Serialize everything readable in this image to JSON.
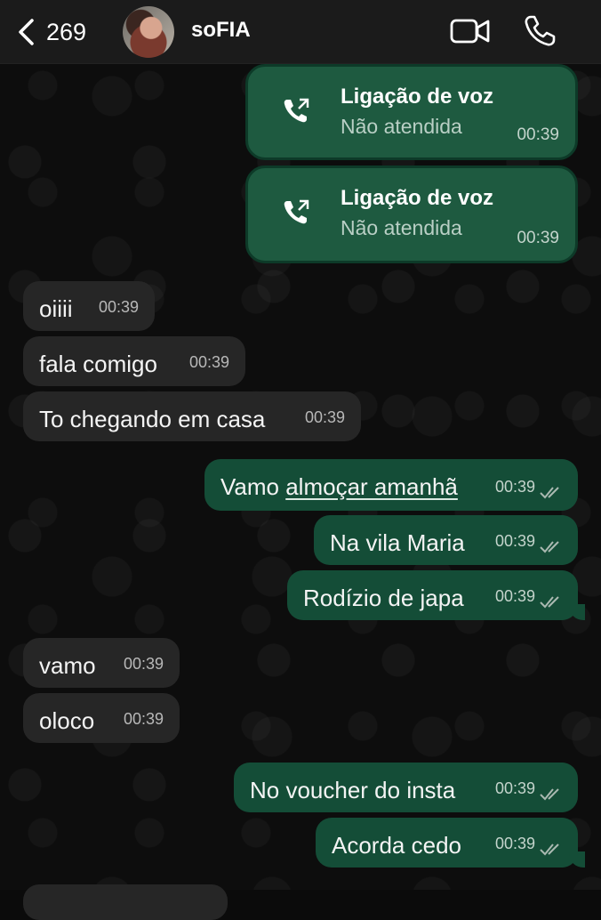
{
  "header": {
    "back_count": "269",
    "contact_name": "soFIA"
  },
  "calls": [
    {
      "title": "Ligação de voz",
      "status": "Não atendida",
      "time": "00:39"
    },
    {
      "title": "Ligação de voz",
      "status": "Não atendida",
      "time": "00:39"
    }
  ],
  "messages": [
    {
      "text": "oiiii",
      "time": "00:39",
      "direction": "in"
    },
    {
      "text": "fala comigo",
      "time": "00:39",
      "direction": "in"
    },
    {
      "text": "To chegando em casa",
      "time": "00:39",
      "direction": "in"
    },
    {
      "text_plain": "Vamo ",
      "text_link": "almoçar amanhã",
      "time": "00:39",
      "direction": "out"
    },
    {
      "text": "Na vila Maria",
      "time": "00:39",
      "direction": "out"
    },
    {
      "text": "Rodízio de japa",
      "time": "00:39",
      "direction": "out"
    },
    {
      "text": "vamo",
      "time": "00:39",
      "direction": "in"
    },
    {
      "text": "oloco",
      "time": "00:39",
      "direction": "in"
    },
    {
      "text": "No voucher do insta",
      "time": "00:39",
      "direction": "out"
    },
    {
      "text": "Acorda cedo",
      "time": "00:39",
      "direction": "out"
    }
  ],
  "colors": {
    "incoming_bubble": "#262626",
    "outgoing_bubble": "#144d37",
    "call_card": "#1e5a40",
    "background": "#0d0d0d"
  }
}
